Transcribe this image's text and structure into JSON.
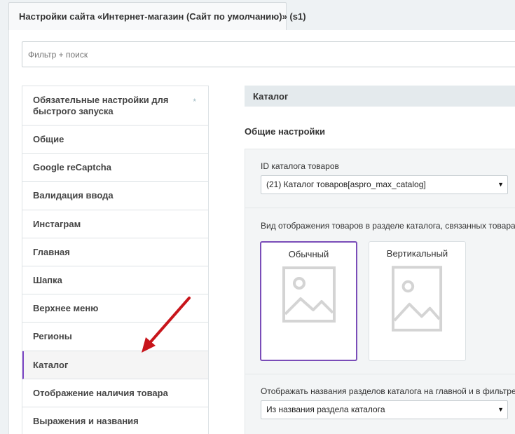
{
  "tab": {
    "title": "Настройки сайта «Интернет-магазин (Сайт по умолчанию)» (s1)"
  },
  "filter": {
    "placeholder": "Фильтр + поиск"
  },
  "sidebar": {
    "items": [
      {
        "label": "Обязательные настройки для быстрого запуска",
        "star": "*"
      },
      {
        "label": "Общие"
      },
      {
        "label": "Google reCaptcha"
      },
      {
        "label": "Валидация ввода"
      },
      {
        "label": "Инстаграм"
      },
      {
        "label": "Главная"
      },
      {
        "label": "Шапка"
      },
      {
        "label": "Верхнее меню"
      },
      {
        "label": "Регионы"
      },
      {
        "label": "Каталог"
      },
      {
        "label": "Отображение наличия товара"
      },
      {
        "label": "Выражения и названия"
      }
    ],
    "active_index": 9
  },
  "content": {
    "section_title": "Каталог",
    "subsection_title": "Общие настройки",
    "catalog_id": {
      "label": "ID каталога товаров",
      "value": "(21) Каталог товаров[aspro_max_catalog]"
    },
    "view_mode": {
      "label": "Вид отображения товаров в разделе каталога, связанных товарах,",
      "options": [
        {
          "label": "Обычный",
          "selected": true
        },
        {
          "label": "Вертикальный",
          "selected": false
        }
      ]
    },
    "section_names": {
      "label": "Отображать названия разделов каталога на главной и в фильтре п",
      "value": "Из названия раздела каталога"
    }
  },
  "colors": {
    "accent": "#7a4db8",
    "arrow": "#c8151b",
    "background": "#eef2f4",
    "section_bg": "#e4eaed"
  }
}
